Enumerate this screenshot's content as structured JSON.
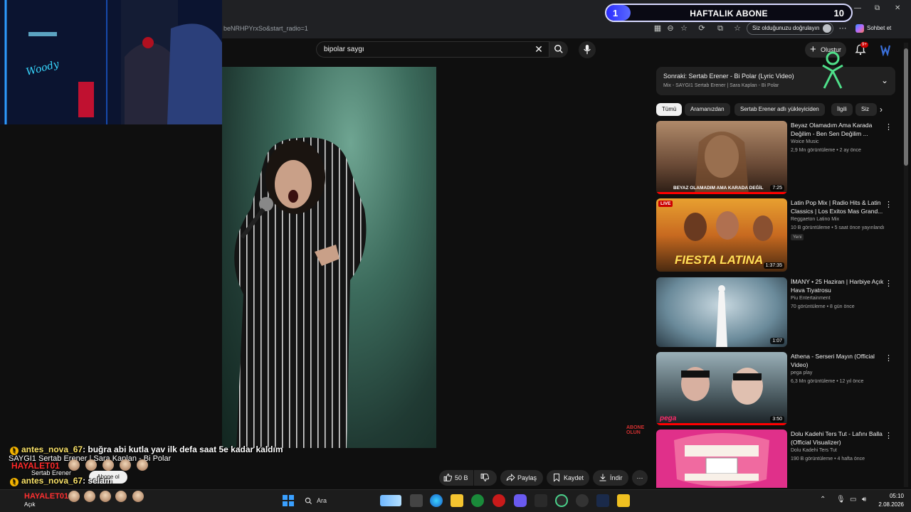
{
  "browser": {
    "url": "beNRHPYrxSo&start_radio=1",
    "verify_label": "Siz olduğunuzu doğrulayın",
    "copilot_label": "Sohbet et"
  },
  "overlay": {
    "weekly_title": "HAFTALIK ABONE",
    "weekly_current": "1",
    "weekly_goal": "10",
    "weekly_progress": 0.1
  },
  "youtube": {
    "search_value": "bipolar saygı",
    "create_label": "Oluştur",
    "notif_count": "9+"
  },
  "upnext": {
    "title": "Sonraki: Sertab Erener - Bi Polar (Lyric Video)",
    "subtitle": "Mix - SAYGI1 Sertab Erener | Sara Kaplan - Bi Polar"
  },
  "chips": [
    "Tümü",
    "Aramanızdan",
    "Sertab Erener adlı yükleyiciden",
    "İlgili",
    "Siz"
  ],
  "recommendations": [
    {
      "title": "Beyaz Olamadım Ama Karada Değilim - Ben Sen Değilim ...",
      "channel": "Woice Music",
      "meta": "2,9 Mn görüntüleme • 2 ay önce",
      "duration": "7:25",
      "thumb_caption": "BEYAZ OLAMADIM AMA KARADA DEĞİL"
    },
    {
      "title": "Latin Pop Mix | Radio Hits & Latin Classics | Los Exitos Mas Grand...",
      "channel": "Reggaeton Latino Mix",
      "meta": "10 B görüntüleme • 5 saat önce yayınlandı",
      "badge": "Yeni",
      "duration": "1:37:35",
      "live_label": "LIVE",
      "thumb_caption": "FIESTA LATINA"
    },
    {
      "title": "İMANY • 25 Haziran | Harbiye Açık Hava Tiyatrosu",
      "channel": "Piu Entertainment",
      "meta": "70 görüntüleme • 8 gün önce",
      "duration": "1:07"
    },
    {
      "title": "Athena - Serseri Mayın (Official Video)",
      "channel": "pega play",
      "meta": "6,3 Mn görüntüleme • 12 yıl önce",
      "duration": "3:50",
      "thumb_caption": "pega"
    },
    {
      "title": "Dolu Kadehi Ters Tut - Lafını Balla (Official Visualizer)",
      "channel": "Dolu Kadehi Ters Tut",
      "meta": "190 B görüntüleme • 4 hafta önce"
    }
  ],
  "actions": {
    "like_count": "50 B",
    "share": "Paylaş",
    "save": "Kaydet",
    "download": "İndir"
  },
  "video_overlay": {
    "abone_line1": "ABONE",
    "abone_line2": "OLUN"
  },
  "chat": {
    "msg1_user": "antes_nova_67",
    "msg1_text": ": buğra abi kutla yav ilk defa saat 5e kadar kaldım",
    "song_line": "SAYGI1 Sertab Erener | Sara Kaplan - Bi Polar",
    "song_artist": "Sertab Erener",
    "sub_button": "Abone ol",
    "hayalet_user": "HAYALET01",
    "msg2_user": "antes_nova_67",
    "msg2_text": ": selam"
  },
  "taskbar": {
    "weather_status": "Açık",
    "search_label": "Ara",
    "time": "05:10",
    "date": "2.08.2026"
  },
  "colors": {
    "accent_red": "#ff0000",
    "weekly_fill": "#2a2bff"
  }
}
